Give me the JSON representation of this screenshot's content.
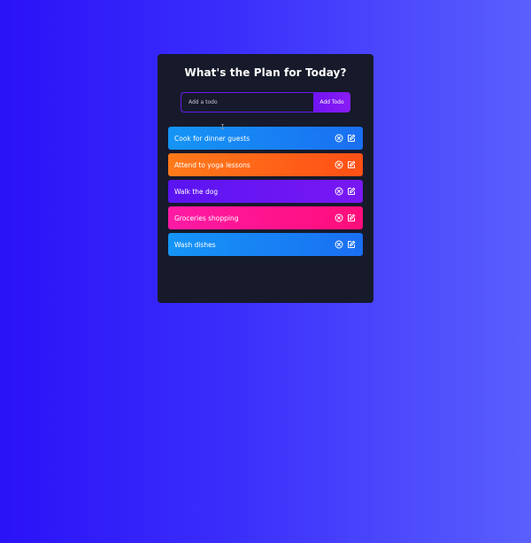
{
  "app": {
    "title": "What's the Plan for Today?",
    "input": {
      "placeholder": "Add a todo",
      "value": ""
    },
    "add_button_label": "Add Todo"
  },
  "todos": [
    {
      "text": "Cook for dinner guests",
      "color": "blue"
    },
    {
      "text": "Attend to yoga lessons",
      "color": "orange"
    },
    {
      "text": "Walk the dog",
      "color": "purple"
    },
    {
      "text": "Groceries shopping",
      "color": "pink"
    },
    {
      "text": "Wash dishes",
      "color": "blue"
    }
  ],
  "icons": {
    "delete": "close-circle-icon",
    "edit": "edit-icon"
  },
  "colors": {
    "background_start": "#2a12f7",
    "background_end": "#5a5ffd",
    "card": "#161a2b",
    "accent": "#7014f2",
    "blue": "#1595f6",
    "orange": "#ff6a18",
    "purple": "#5a14f2",
    "pink": "#ff1aa5"
  }
}
